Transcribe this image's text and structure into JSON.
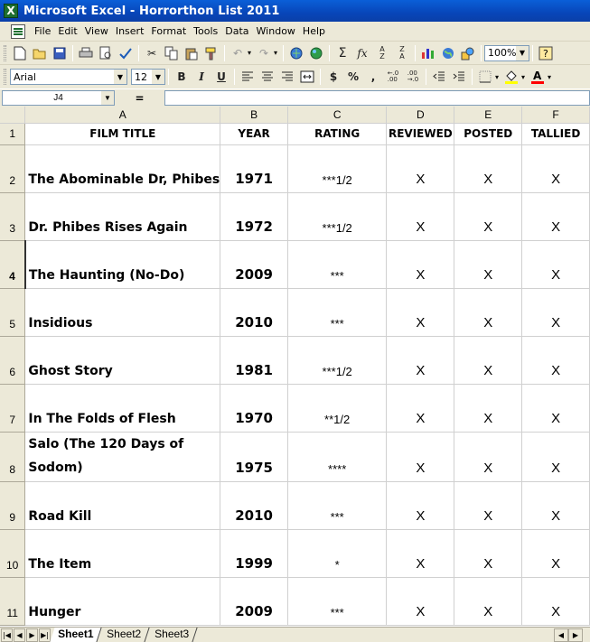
{
  "window": {
    "title": "Microsoft Excel - Horrorthon List 2011",
    "app_icon": "X"
  },
  "menu": [
    "File",
    "Edit",
    "View",
    "Insert",
    "Format",
    "Tools",
    "Data",
    "Window",
    "Help"
  ],
  "toolbar": {
    "zoom": "100%",
    "font_name": "Arial",
    "font_size": "12"
  },
  "formula_bar": {
    "name_box": "J4",
    "equals": "=",
    "formula": ""
  },
  "columns": [
    "A",
    "B",
    "C",
    "D",
    "E",
    "F"
  ],
  "header": {
    "row_number": "1",
    "film_title": "FILM TITLE",
    "year": "YEAR",
    "rating": "RATING",
    "reviewed": "REVIEWED",
    "posted": "POSTED",
    "tallied": "TALLIED"
  },
  "rows": [
    {
      "n": "2",
      "title": "The Abominable Dr, Phibes",
      "year": "1971",
      "rating": "***1/2",
      "reviewed": "X",
      "posted": "X",
      "tallied": "X"
    },
    {
      "n": "3",
      "title": "Dr. Phibes Rises Again",
      "year": "1972",
      "rating": "***1/2",
      "reviewed": "X",
      "posted": "X",
      "tallied": "X"
    },
    {
      "n": "4",
      "title": "The Haunting (No-Do)",
      "year": "2009",
      "rating": "***",
      "reviewed": "X",
      "posted": "X",
      "tallied": "X"
    },
    {
      "n": "5",
      "title": "Insidious",
      "year": "2010",
      "rating": "***",
      "reviewed": "X",
      "posted": "X",
      "tallied": "X"
    },
    {
      "n": "6",
      "title": "Ghost Story",
      "year": "1981",
      "rating": "***1/2",
      "reviewed": "X",
      "posted": "X",
      "tallied": "X"
    },
    {
      "n": "7",
      "title": "In The Folds of Flesh",
      "year": "1970",
      "rating": "**1/2",
      "reviewed": "X",
      "posted": "X",
      "tallied": "X"
    },
    {
      "n": "8",
      "title": "Salo (The 120 Days of Sodom)",
      "year": "1975",
      "rating": "****",
      "reviewed": "X",
      "posted": "X",
      "tallied": "X"
    },
    {
      "n": "9",
      "title": "Road Kill",
      "year": "2010",
      "rating": "***",
      "reviewed": "X",
      "posted": "X",
      "tallied": "X"
    },
    {
      "n": "10",
      "title": "The Item",
      "year": "1999",
      "rating": "*",
      "reviewed": "X",
      "posted": "X",
      "tallied": "X"
    },
    {
      "n": "11",
      "title": "Hunger",
      "year": "2009",
      "rating": "***",
      "reviewed": "X",
      "posted": "X",
      "tallied": "X"
    }
  ],
  "sheets": [
    "Sheet1",
    "Sheet2",
    "Sheet3"
  ]
}
